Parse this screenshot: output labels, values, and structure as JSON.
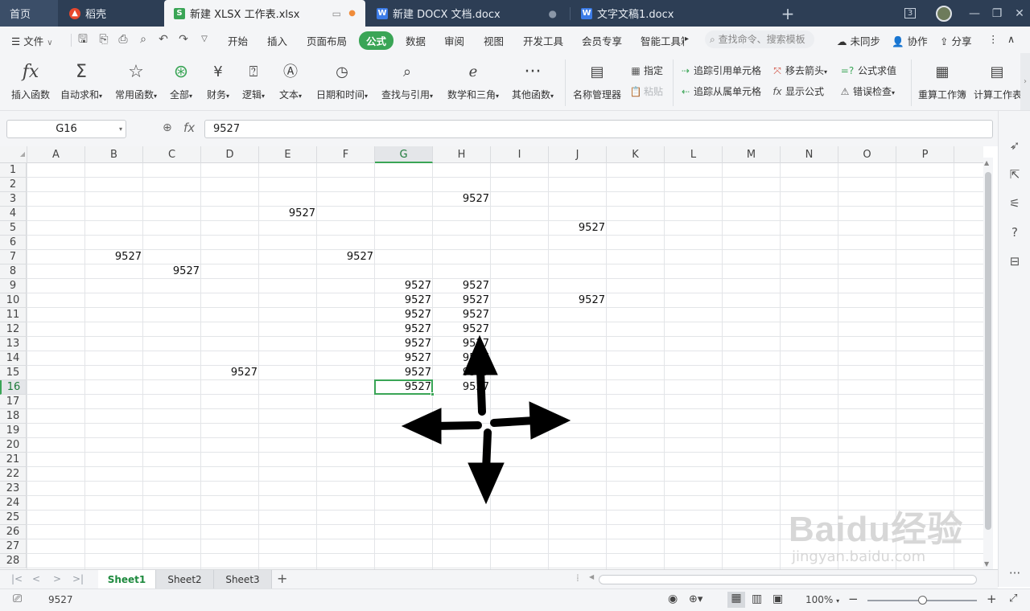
{
  "tabs": {
    "home": "首页",
    "docer": "稻壳",
    "xlsx": "新建 XLSX 工作表.xlsx",
    "docx": "新建 DOCX 文档.docx",
    "doc1": "文字文稿1.docx",
    "new_tab": "+",
    "window_count": "3"
  },
  "menu": {
    "file": "文件",
    "items": [
      "开始",
      "插入",
      "页面布局",
      "公式",
      "数据",
      "审阅",
      "视图",
      "开发工具",
      "会员专享",
      "智能工具箱"
    ],
    "active": "公式",
    "search_placeholder": "查找命令、搜索模板",
    "sync": "未同步",
    "collab": "协作",
    "share": "分享"
  },
  "ribbon": {
    "insert_fn": "插入函数",
    "autosum": "自动求和",
    "common_fn": "常用函数",
    "all": "全部",
    "finance": "财务",
    "logic": "逻辑",
    "text": "文本",
    "datetime": "日期和时间",
    "lookup": "查找与引用",
    "math": "数学和三角",
    "other_fn": "其他函数",
    "name_mgr": "名称管理器",
    "assign": "指定",
    "paste": "粘贴",
    "trace_prec": "追踪引用单元格",
    "trace_dep": "追踪从属单元格",
    "remove_arrows": "移去箭头",
    "show_formula": "显示公式",
    "eval_formula": "公式求值",
    "error_check": "错误检查",
    "recalc_book": "重算工作簿",
    "calc_sheet": "计算工作表"
  },
  "formula_bar": {
    "name_box": "G16",
    "fx": "fx",
    "value": "9527"
  },
  "columns": [
    "A",
    "B",
    "C",
    "D",
    "E",
    "F",
    "G",
    "H",
    "I",
    "J",
    "K",
    "L",
    "M",
    "N",
    "O",
    "P"
  ],
  "rows": [
    "1",
    "2",
    "3",
    "4",
    "5",
    "6",
    "7",
    "8",
    "9",
    "10",
    "11",
    "12",
    "13",
    "14",
    "15",
    "16",
    "17",
    "18",
    "19",
    "20",
    "21",
    "22",
    "23",
    "24",
    "25",
    "26",
    "27",
    "28"
  ],
  "selected": {
    "col": "G",
    "row": "16"
  },
  "cells": [
    {
      "ref": "H3",
      "value": "9527"
    },
    {
      "ref": "E4",
      "value": "9527"
    },
    {
      "ref": "J5",
      "value": "9527"
    },
    {
      "ref": "B7",
      "value": "9527"
    },
    {
      "ref": "F7",
      "value": "9527"
    },
    {
      "ref": "C8",
      "value": "9527"
    },
    {
      "ref": "G9",
      "value": "9527"
    },
    {
      "ref": "H9",
      "value": "9527"
    },
    {
      "ref": "G10",
      "value": "9527"
    },
    {
      "ref": "H10",
      "value": "9527"
    },
    {
      "ref": "J10",
      "value": "9527"
    },
    {
      "ref": "G11",
      "value": "9527"
    },
    {
      "ref": "H11",
      "value": "9527"
    },
    {
      "ref": "G12",
      "value": "9527"
    },
    {
      "ref": "H12",
      "value": "9527"
    },
    {
      "ref": "G13",
      "value": "9527"
    },
    {
      "ref": "H13",
      "value": "9527"
    },
    {
      "ref": "G14",
      "value": "9527"
    },
    {
      "ref": "H14",
      "value": "9527"
    },
    {
      "ref": "D15",
      "value": "9527"
    },
    {
      "ref": "G15",
      "value": "9527"
    },
    {
      "ref": "H15",
      "value": "9527"
    },
    {
      "ref": "G16",
      "value": "9527"
    },
    {
      "ref": "H16",
      "value": "9527"
    }
  ],
  "sheets": [
    "Sheet1",
    "Sheet2",
    "Sheet3"
  ],
  "active_sheet": "Sheet1",
  "add_sheet": "+",
  "status": {
    "value": "9527",
    "zoom": "100%",
    "zoom_level": 1.0
  },
  "watermark": {
    "main": "Baidu经验",
    "sub": "jingyan.baidu.com"
  },
  "colors": {
    "accent": "#3aa556",
    "titlebar": "#2d3e55",
    "chrome": "#f4f5f7"
  }
}
